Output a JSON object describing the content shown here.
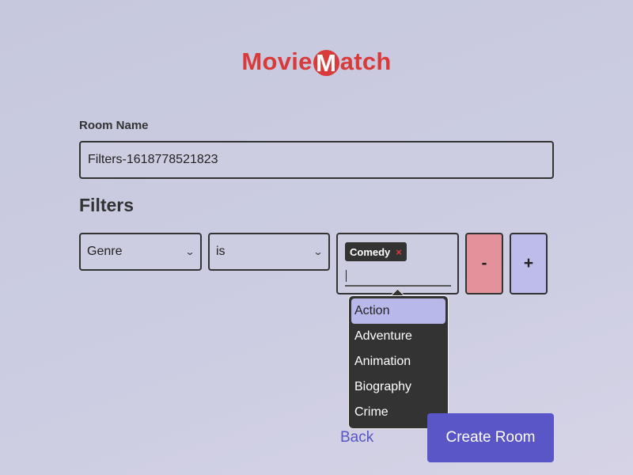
{
  "app": {
    "logo_prefix": "Movie",
    "logo_m": "M",
    "logo_suffix": "atch",
    "brand_color": "#d93a3a"
  },
  "room": {
    "label": "Room Name",
    "value": "Filters-1618778521823"
  },
  "filters": {
    "heading": "Filters",
    "rows": [
      {
        "field": "Genre",
        "operator": "is",
        "tags": [
          {
            "label": "Comedy",
            "remove_icon": "×"
          }
        ],
        "remove_label": "-",
        "add_label": "+"
      }
    ],
    "dropdown_options": [
      "Action",
      "Adventure",
      "Animation",
      "Biography",
      "Crime"
    ],
    "highlighted_option": "Action"
  },
  "icons": {
    "select_chevron": "chevron-down-icon",
    "tag_remove": "close-icon"
  },
  "actions": {
    "back_label": "Back",
    "create_label": "Create Room"
  },
  "colors": {
    "accent": "#5a56c8",
    "minus_button": "#e3919a",
    "plus_button": "#bdbcea",
    "dropdown_bg": "#333333",
    "dropdown_highlight": "#b9b8ea"
  }
}
